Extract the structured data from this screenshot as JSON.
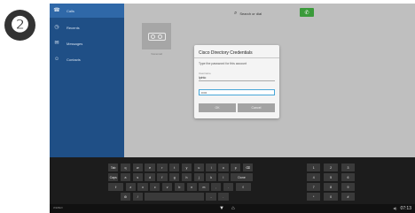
{
  "step_badge": "❷",
  "sidebar": {
    "items": [
      {
        "label": "Calls",
        "icon": "phone-icon",
        "glyph": "☎",
        "active": true
      },
      {
        "label": "Recents",
        "icon": "clock-icon",
        "glyph": "◷",
        "active": false
      },
      {
        "label": "Messages",
        "icon": "message-icon",
        "glyph": "✉",
        "active": false
      },
      {
        "label": "Contacts",
        "icon": "contacts-icon",
        "glyph": "☺",
        "active": false
      }
    ]
  },
  "search": {
    "placeholder": "Search or dial",
    "icon": "search-icon"
  },
  "call_button": {
    "glyph": "✆"
  },
  "voicemail_tile": {
    "label": "Voicemail"
  },
  "dialog": {
    "title": "Cisco Directory Credentials",
    "prompt": "Type the password for this account",
    "username_label": "Username",
    "username_value": "lpinto",
    "password_value": "•••••",
    "ok_label": "OK",
    "cancel_label": "Cancel"
  },
  "keyboard": {
    "rows": [
      [
        "Tab",
        "q",
        "w",
        "e",
        "r",
        "t",
        "y",
        "u",
        "i",
        "o",
        "p",
        "⌫"
      ],
      [
        "Caps",
        "a",
        "s",
        "d",
        "f",
        "g",
        "h",
        "j",
        "k",
        "l",
        "Done"
      ],
      [
        "⇧",
        "z",
        "x",
        "c",
        "v",
        "b",
        "n",
        "m",
        ",",
        ".",
        "⇧"
      ],
      [
        "⚙",
        "/",
        "",
        "-",
        "."
      ]
    ],
    "numpad": [
      [
        "1",
        "2",
        "3"
      ],
      [
        "4",
        "5",
        "6"
      ],
      [
        "7",
        "8",
        "9"
      ],
      [
        "*",
        "0",
        "#"
      ]
    ]
  },
  "navbar": {
    "left_label": "WEBEX",
    "back_glyph": "▼",
    "home_glyph": "⌂",
    "volume_glyph": "◀)",
    "time": "07:13"
  }
}
